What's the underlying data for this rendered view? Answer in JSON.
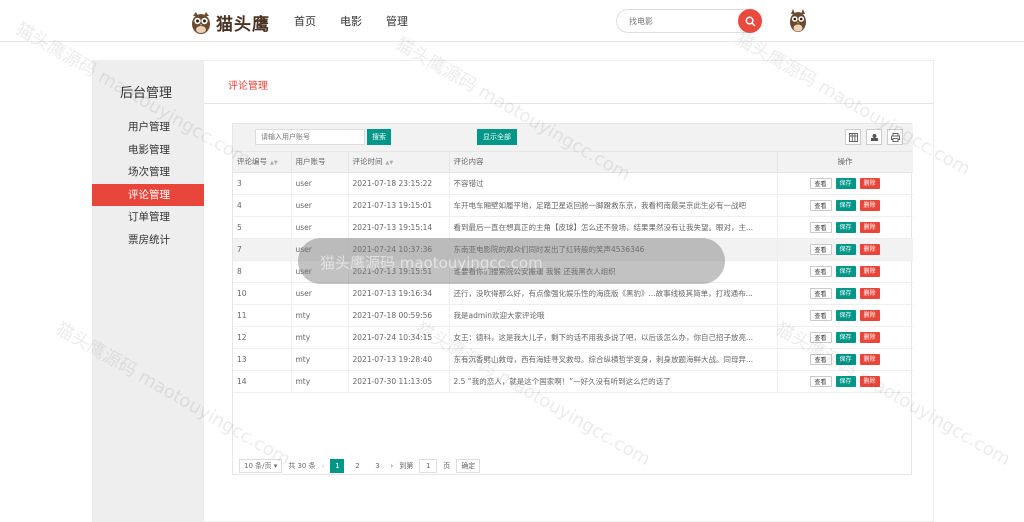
{
  "brand": {
    "name": "猫头鹰"
  },
  "nav": [
    {
      "label": "首页"
    },
    {
      "label": "电影"
    },
    {
      "label": "管理"
    }
  ],
  "search": {
    "placeholder": "找电影"
  },
  "sidebar": {
    "title": "后台管理",
    "items": [
      {
        "label": "用户管理",
        "active": false
      },
      {
        "label": "电影管理",
        "active": false
      },
      {
        "label": "场次管理",
        "active": false
      },
      {
        "label": "评论管理",
        "active": true
      },
      {
        "label": "订单管理",
        "active": false
      },
      {
        "label": "票房统计",
        "active": false
      }
    ]
  },
  "page": {
    "title": "评论管理"
  },
  "toolbar": {
    "input_placeholder": "请输入用户账号",
    "search_label": "搜索",
    "show_all_label": "显示全部"
  },
  "table": {
    "columns": [
      "评论编号",
      "用户账号",
      "评论时间",
      "评论内容",
      "操作"
    ],
    "actions": {
      "view": "查看",
      "save": "保存",
      "delete": "删除"
    },
    "rows": [
      {
        "id": "3",
        "user": "user",
        "time": "2021-07-18 23:15:22",
        "content": "不容错过"
      },
      {
        "id": "4",
        "user": "user",
        "time": "2021-07-13 19:15:01",
        "content": "车开电车厢壁如履平地，足踏卫星返回舱一脚蹬救东京，我看柯南最吴京此生必有一战吧"
      },
      {
        "id": "5",
        "user": "user",
        "time": "2021-07-13 19:15:14",
        "content": "看到最后一直在想真正的主角【皮球】怎么还不登场，结果果然没有让我失望。眼对，主..."
      },
      {
        "id": "7",
        "user": "user",
        "time": "2021-07-24 10:37:36",
        "content": "东南亚电影院的观众们同时发出了红转般的笑声4536346"
      },
      {
        "id": "8",
        "user": "user",
        "time": "2021-07-13 19:15:51",
        "content": "谁要看你们搜索院公安搬運 我猴 还我黑衣人组织"
      },
      {
        "id": "10",
        "user": "user",
        "time": "2021-07-13 19:16:34",
        "content": "还行，没吹得那么好，有点像强化娱乐性的海底版《黑豹》...故事线极其简单，打戏通布..."
      },
      {
        "id": "11",
        "user": "mty",
        "time": "2021-07-18 00:59:56",
        "content": "我是admin欢迎大家评论哦"
      },
      {
        "id": "12",
        "user": "mty",
        "time": "2021-07-24 10:34:15",
        "content": "女王：德科，这是我大儿子，剩下的话不用我多说了吧，以后该怎么办，你自己招子放亮..."
      },
      {
        "id": "13",
        "user": "mty",
        "time": "2021-07-13 19:28:40",
        "content": "东有沉香劈山救母，西有海娃寻叉救母。综合纵横哲学变身，刺身放题海鲜大战。同母异..."
      },
      {
        "id": "14",
        "user": "mty",
        "time": "2021-07-30 11:13:05",
        "content": "2.5 “我的恋人，就是这个国家啊！”—好久没有听到这么烂的话了"
      }
    ],
    "highlighted_row_index": 3
  },
  "pagination": {
    "page_size": "10 条/页",
    "total": "共 30 条",
    "pages": [
      "1",
      "2",
      "3"
    ],
    "current_page": "1",
    "goto_label": "到第",
    "page_unit": "页",
    "confirm_label": "确定",
    "goto_value": "1"
  },
  "watermark": {
    "text": "猫头鹰源码 maotouyingcc.com"
  },
  "colors": {
    "accent_red": "#e8463a",
    "accent_green": "#009688",
    "sidebar_bg": "#eeeeee"
  }
}
